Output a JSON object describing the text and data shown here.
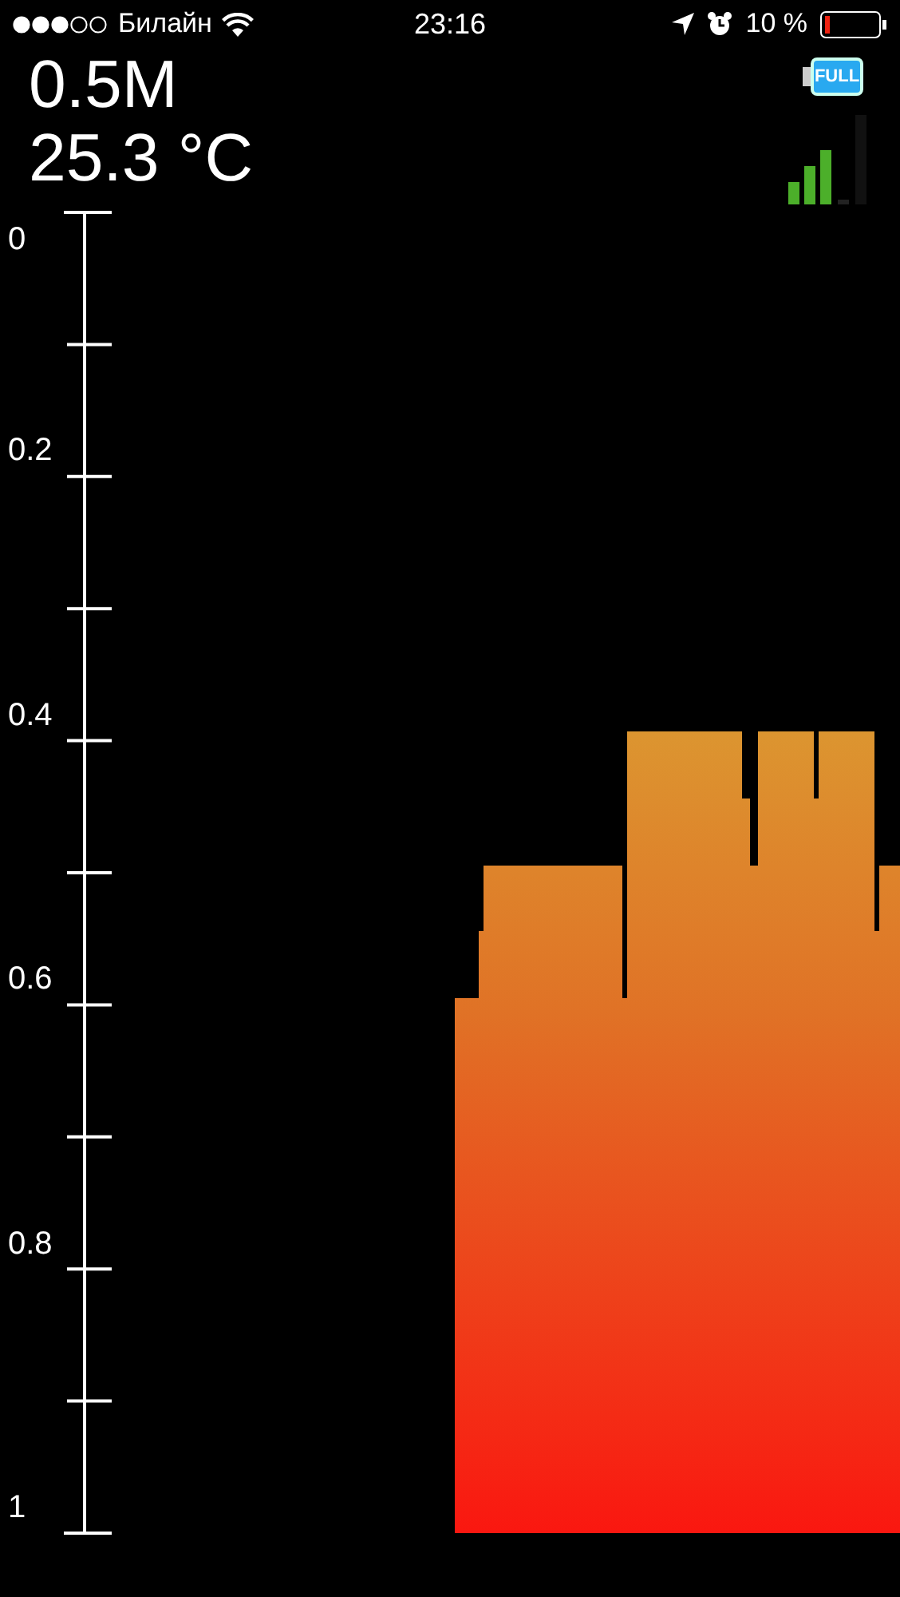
{
  "status_bar": {
    "carrier": "Билайн",
    "time": "23:16",
    "battery": "10 %"
  },
  "readout": {
    "depth": "0.5M",
    "temperature": "25.3 °C"
  },
  "device_battery": {
    "label": "FULL"
  },
  "depth_scale": {
    "labels": [
      "0",
      "0.2",
      "0.4",
      "0.6",
      "0.8",
      "1"
    ]
  }
}
